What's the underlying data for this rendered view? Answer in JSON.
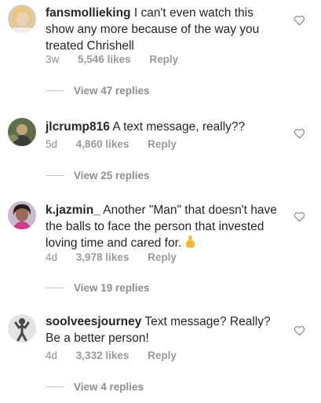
{
  "comments": [
    {
      "username": "fansmollieking",
      "text": "I can't even watch this show any more because of the way you treated Chrishell",
      "time": "3w",
      "likes": "5,546 likes",
      "reply": "Reply",
      "view_replies": "View 47 replies"
    },
    {
      "username": "jlcrump816",
      "text": "A text message, really??",
      "time": "5d",
      "likes": "4,860 likes",
      "reply": "Reply",
      "view_replies": "View 25 replies"
    },
    {
      "username": "k.jazmin_",
      "text": "Another \"Man\" that doesn't have the balls to face the person that invested loving time and cared for.",
      "time": "4d",
      "likes": "3,978 likes",
      "reply": "Reply",
      "view_replies": "View 19 replies"
    },
    {
      "username": "soolveesjourney",
      "text": "Text message? Really? Be a better person!",
      "time": "4d",
      "likes": "3,332 likes",
      "reply": "Reply",
      "view_replies": "View 4 replies"
    }
  ],
  "icons": {
    "like": "heart-outline-icon",
    "emoji": "pointing-up-emoji"
  }
}
